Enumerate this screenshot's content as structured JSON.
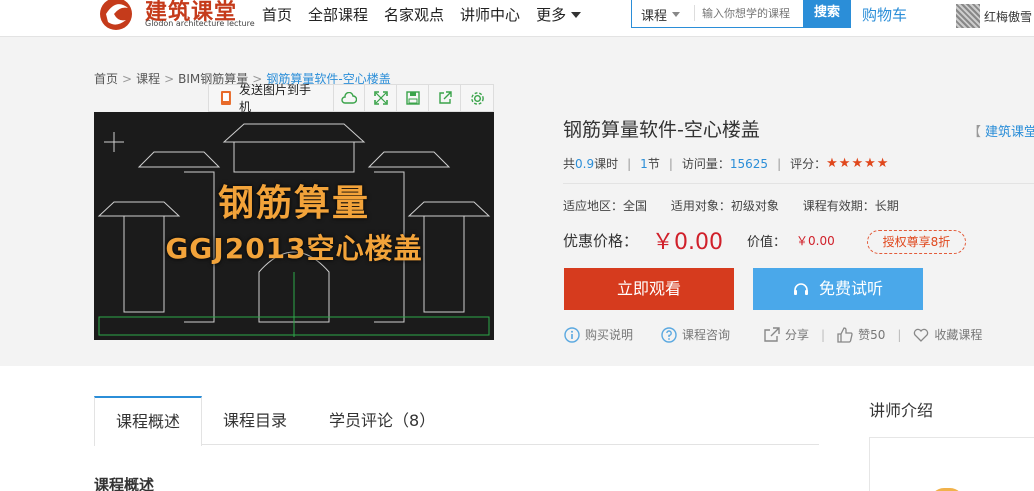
{
  "header": {
    "logo_text": "建筑课堂",
    "logo_sub": "Glodon architecture lecture",
    "nav": [
      "首页",
      "全部课程",
      "名家观点",
      "讲师中心"
    ],
    "nav_more": "更多",
    "search": {
      "category": "课程",
      "placeholder": "输入你想学的课程",
      "button": "搜索"
    },
    "cart": "购物车",
    "user_name": "红梅傲雪"
  },
  "breadcrumb": {
    "items": [
      "首页",
      "课程",
      "BIM钢筋算量"
    ],
    "current": "钢筋算量软件-空心楼盖"
  },
  "toolbar": {
    "send_label": "发送图片到手机"
  },
  "cover": {
    "line1": "钢筋算量",
    "line2": "GGJ2013空心楼盖"
  },
  "course": {
    "title": "钢筋算量软件-空心楼盖",
    "brand": "建筑课堂",
    "hours_prefix": "共",
    "hours_value": "0.9",
    "hours_suffix": "课时",
    "lessons_value": "1",
    "lessons_suffix": "节",
    "visits_label": "访问量：",
    "visits_value": "15625",
    "rating_label": "评分：",
    "rating_stars": 5,
    "region_label": "适应地区：",
    "region_value": "全国",
    "audience_label": "适用对象：",
    "audience_value": "初级对象",
    "validity_label": "课程有效期：",
    "validity_value": "长期",
    "price_label": "优惠价格：",
    "price_value": "￥0.00",
    "value_label": "价值：",
    "value_value": "￥0.00",
    "discount_badge": "授权尊享8折",
    "watch_button": "立即观看",
    "trial_button": "免费试听"
  },
  "actions": {
    "buy_info": "购买说明",
    "consult": "课程咨询",
    "share": "分享",
    "like": "赞50",
    "favorite": "收藏课程"
  },
  "tabs": [
    "课程概述",
    "课程目录",
    "学员评论（8）"
  ],
  "section_title": "课程概述",
  "teacher_title": "讲师介绍",
  "colors": {
    "blue": "#2b8ed8",
    "red": "#d63b1e",
    "light_blue": "#4aa8ea",
    "gold": "#f2a33a"
  }
}
